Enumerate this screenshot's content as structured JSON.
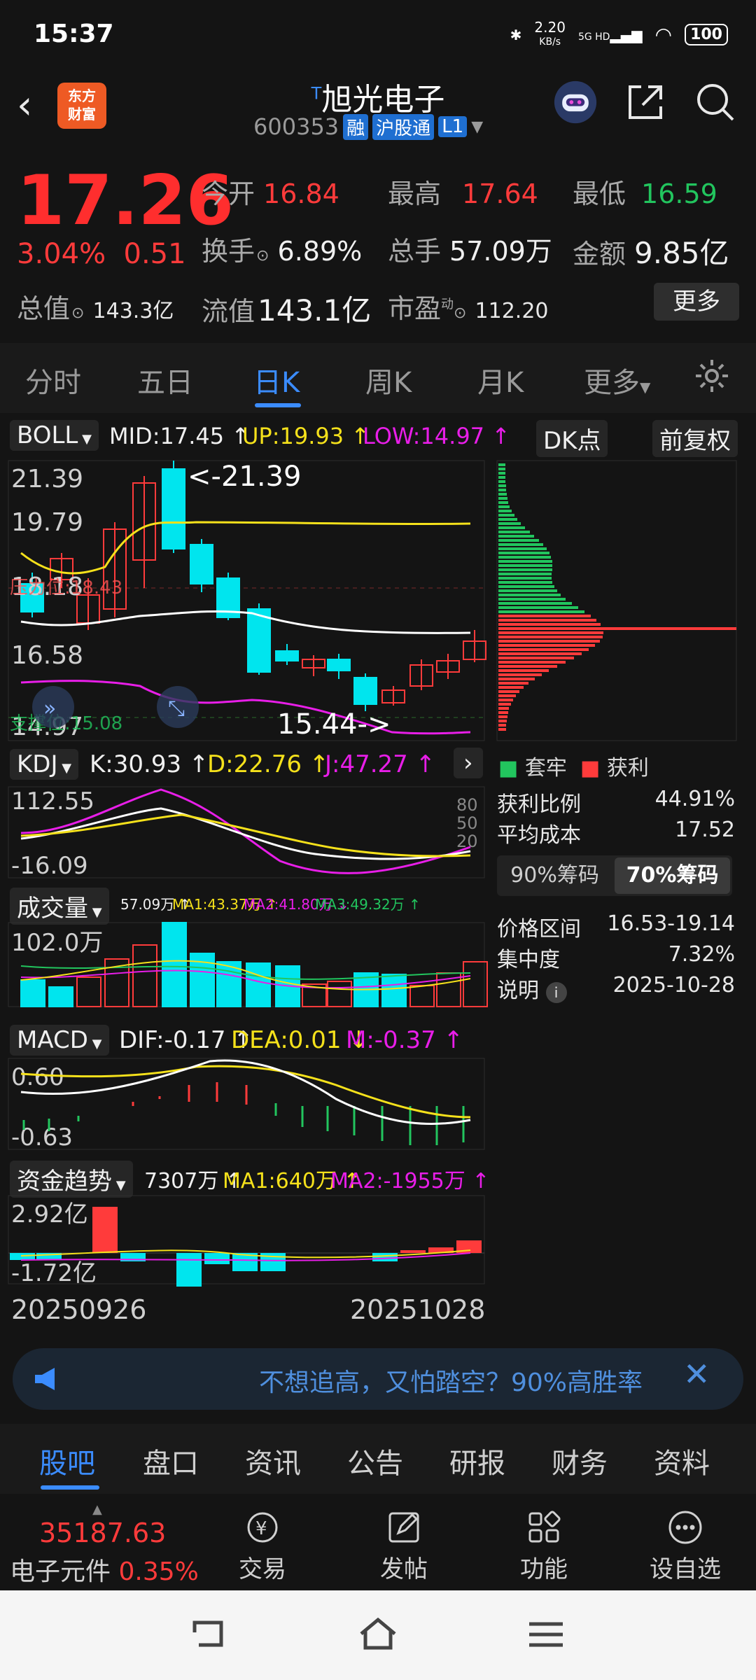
{
  "status_bar": {
    "time": "15:37",
    "net_speed": "2.20",
    "net_unit": "KB/s",
    "net_type": "5G HD",
    "battery": "100"
  },
  "header": {
    "logo_line1": "东方",
    "logo_line2": "财富",
    "title": "旭光电子",
    "title_mark": "T",
    "code": "600353",
    "tags": [
      "融",
      "沪股通",
      "L1"
    ]
  },
  "quote": {
    "price": "17.26",
    "pct": "3.04%",
    "change": "0.51",
    "open_label": "今开",
    "open": "16.84",
    "high_label": "最高",
    "high": "17.64",
    "low_label": "最低",
    "low": "16.59",
    "turnover_label": "换手",
    "turnover": "6.89%",
    "volume_label": "总手",
    "volume": "57.09万",
    "amount_label": "金额",
    "amount": "9.85亿",
    "mcap_label": "总值",
    "mcap": "143.3亿",
    "float_label": "流值",
    "float_cap": "143.1亿",
    "pe_label": "市盈",
    "pe_mark": "动",
    "pe": "112.20",
    "more": "更多"
  },
  "tabs": [
    "分时",
    "五日",
    "日K",
    "周K",
    "月K",
    "更多",
    "settings-icon"
  ],
  "boll": {
    "name": "BOLL",
    "mid": "MID:17.45 ↑",
    "up": "UP:19.93 ↑",
    "low": "LOW:14.97 ↑",
    "dk": "DK点",
    "fq": "前复权",
    "y_labels": [
      "21.39",
      "19.79",
      "18.18",
      "16.58",
      "14.97"
    ],
    "mark_high": "<-21.39",
    "mark_low": "15.44->",
    "line1": "压力位:18.43",
    "line2": "支撑位:15.08"
  },
  "kdj": {
    "name": "KDJ",
    "k": "K:30.93 ↑",
    "d": "D:22.76 ↑",
    "j": "J:47.27 ↑",
    "y_top": "112.55",
    "y_bot": "-16.09",
    "levels": [
      "80",
      "50",
      "20"
    ]
  },
  "vol": {
    "name": "成交量",
    "v": "57.09万 ↑",
    "ma1": "MA1:43.37万 ↑",
    "ma2": "MA2:41.80万 ↓",
    "ma3": "MA3:49.32万 ↑",
    "y_top": "102.0万"
  },
  "macd": {
    "name": "MACD",
    "dif": "DIF:-0.17 ↑",
    "dea": "DEA:0.01 ↓",
    "m": "M:-0.37 ↑",
    "y_top": "0.60",
    "y_bot": "-0.63"
  },
  "fund": {
    "name": "资金趋势",
    "v": "7307万 ↑",
    "ma1": "MA1:640万 ↑",
    "ma2": "MA2:-1955万 ↑",
    "y_top": "2.92亿",
    "y_bot": "-1.72亿"
  },
  "dates": {
    "start": "20250926",
    "end": "20251028"
  },
  "chips": {
    "legend_trap": "套牢",
    "legend_profit": "获利",
    "rows": [
      {
        "k": "获利比例",
        "v": "44.91%"
      },
      {
        "k": "平均成本",
        "v": "17.52"
      }
    ],
    "btn90": "90%筹码",
    "btn70": "70%筹码",
    "rows2": [
      {
        "k": "价格区间",
        "v": "16.53-19.14"
      },
      {
        "k": "集中度",
        "v": "7.32%"
      },
      {
        "k": "说明",
        "v": "2025-10-28"
      }
    ]
  },
  "banner": {
    "text": "不想追高，又怕踏空？90%高胜率"
  },
  "bottom_tabs": [
    "股吧",
    "盘口",
    "资讯",
    "公告",
    "研报",
    "财务",
    "资料"
  ],
  "toolbar": {
    "index_value": "35187.63",
    "index_name": "电子元件",
    "index_pct": "0.35%",
    "items": [
      "交易",
      "发帖",
      "功能",
      "设自选"
    ]
  },
  "colors": {
    "up": "#ff3b3b",
    "down": "#00e5ee",
    "accent": "#3b8cff",
    "mid": "#ffffff",
    "upper": "#f5e11b",
    "lower": "#e81ee8"
  }
}
